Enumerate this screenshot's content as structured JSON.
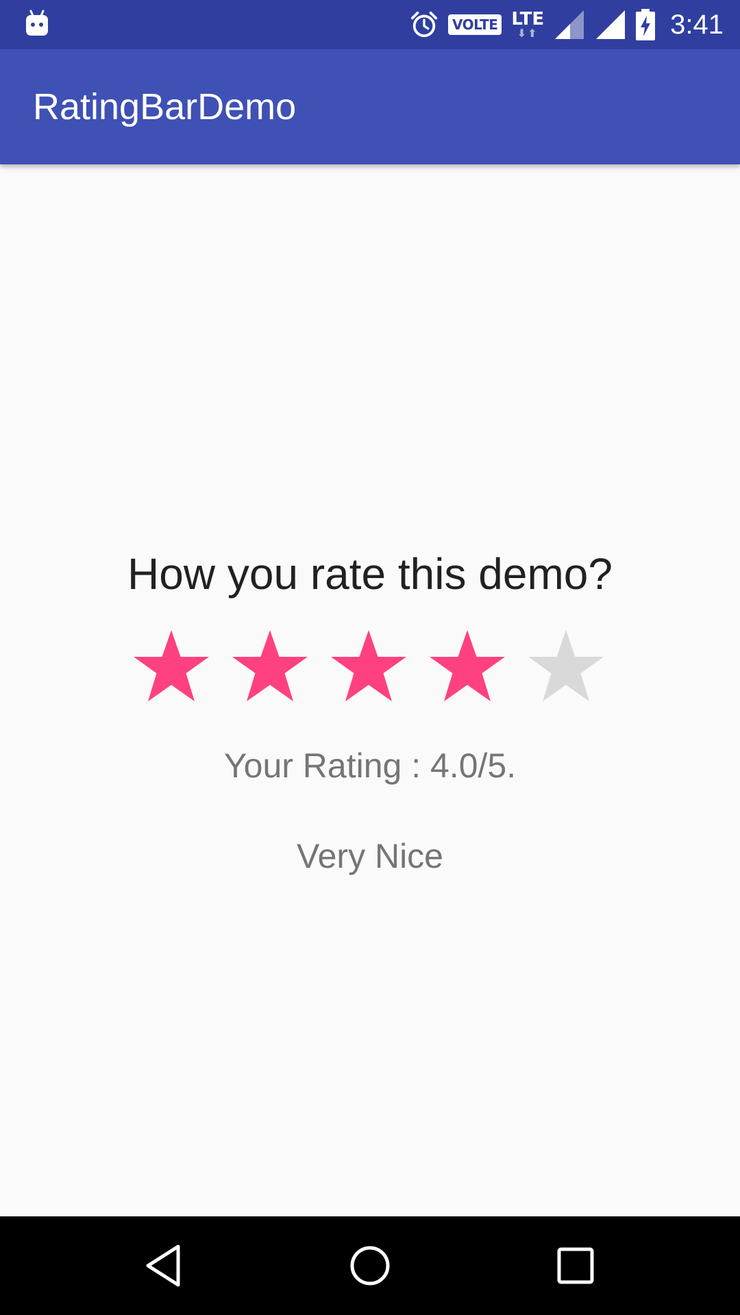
{
  "status_bar": {
    "time": "3:41",
    "volte_label": "VOLTE",
    "lte_label": "LTE",
    "icons": [
      "android-icon",
      "alarm-icon",
      "volte-icon",
      "lte-icon",
      "signal-icon",
      "signal-icon",
      "battery-charging-icon"
    ],
    "background_color": "#303f9f"
  },
  "app_bar": {
    "title": "RatingBarDemo",
    "background_color": "#3f51b5"
  },
  "content": {
    "question": "How you rate this demo?",
    "rating": {
      "value": 4.0,
      "max": 5,
      "filled_color": "#ff4081",
      "empty_color": "#d9d9d9"
    },
    "rating_text": "Your Rating : 4.0/5.",
    "comment": "Very Nice"
  },
  "nav_bar": {
    "icons": [
      "back-icon",
      "home-icon",
      "recents-icon"
    ]
  }
}
